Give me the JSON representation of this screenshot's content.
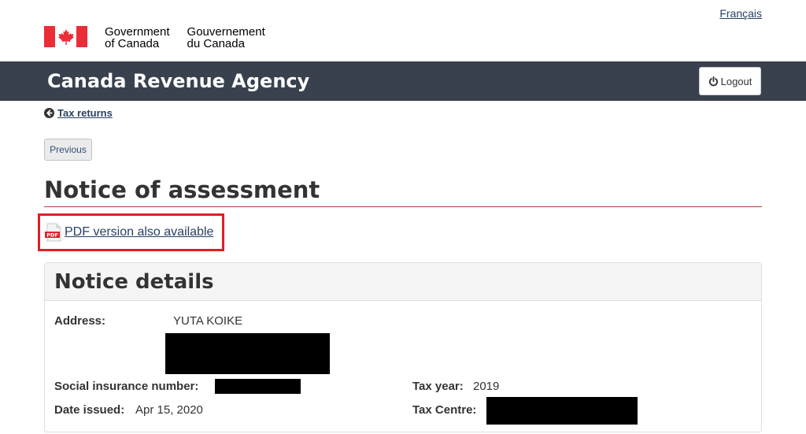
{
  "header": {
    "language_link": "Français",
    "signature_en_line1": "Government",
    "signature_en_line2": "of Canada",
    "signature_fr_line1": "Gouvernement",
    "signature_fr_line2": "du Canada",
    "flag_icon": "canada-flag-icon"
  },
  "app_bar": {
    "title": "Canada Revenue Agency",
    "logout_label": "Logout",
    "logout_icon": "power-icon",
    "background": "#38414d"
  },
  "nav": {
    "back_label": "Tax returns",
    "back_icon": "circle-arrow-left-icon",
    "previous_label": "Previous"
  },
  "page": {
    "title": "Notice of assessment",
    "pdf_label": "PDF version also available",
    "pdf_icon": "pdf-file-icon",
    "highlight_color": "#e01e26"
  },
  "notice": {
    "title": "Notice details",
    "address_label": "Address:",
    "address_name": "YUTA KOIKE",
    "sin_label": "Social insurance number:",
    "date_label": "Date issued:",
    "date_value": "Apr 15, 2020",
    "tax_year_label": "Tax year:",
    "tax_year_value": "2019",
    "tax_centre_label": "Tax Centre:"
  }
}
